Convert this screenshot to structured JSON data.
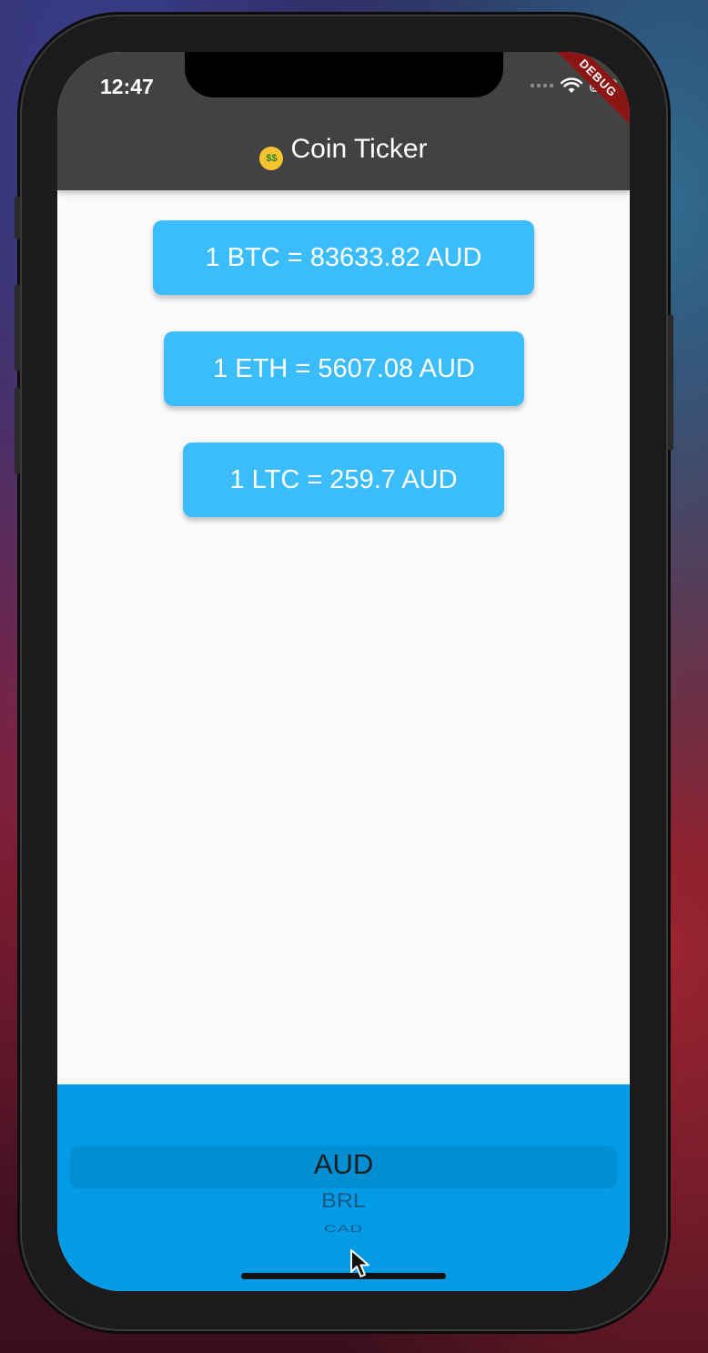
{
  "status_bar": {
    "time": "12:47"
  },
  "debug_banner": "DEBUG",
  "app_bar": {
    "title": "Coin Ticker",
    "emoji": "$$"
  },
  "rates": [
    {
      "label": "1 BTC = 83633.82 AUD"
    },
    {
      "label": "1 ETH = 5607.08 AUD"
    },
    {
      "label": "1 LTC = 259.7 AUD"
    }
  ],
  "currency_picker": {
    "items": [
      "AUD",
      "BRL",
      "CAD"
    ],
    "selected": "AUD"
  },
  "colors": {
    "app_bar": "#424242",
    "card": "#3bbdfb",
    "picker_bg": "#039be5",
    "debug_banner": "#8b1515"
  }
}
